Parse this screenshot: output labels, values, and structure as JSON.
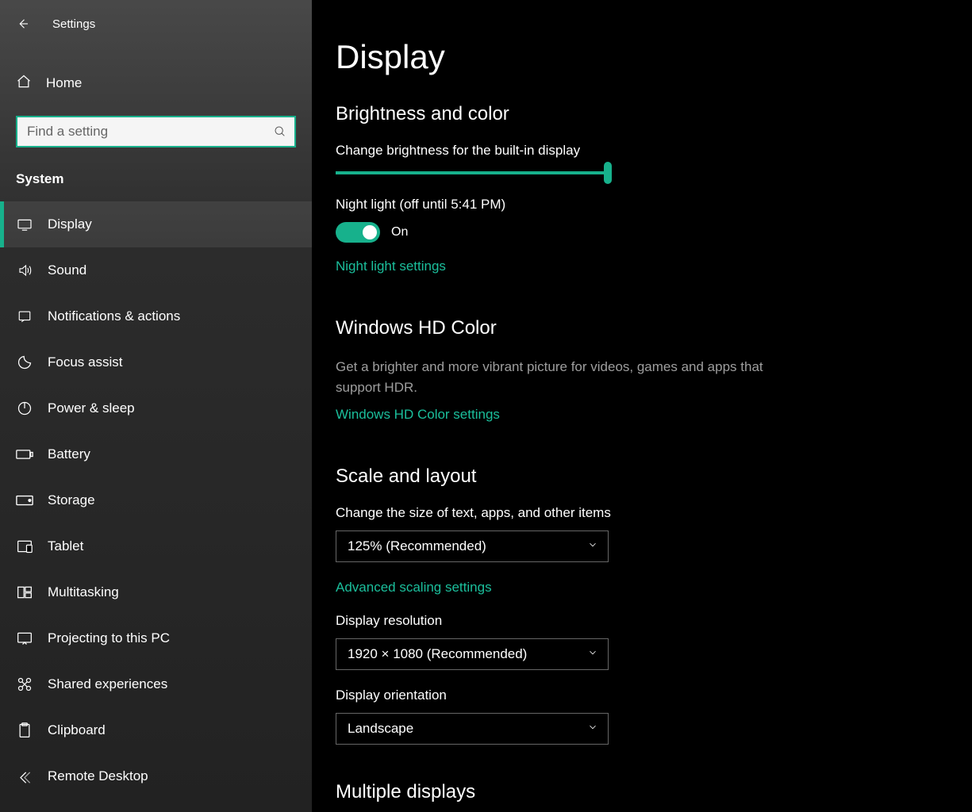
{
  "titlebar": {
    "title": "Settings"
  },
  "home": {
    "label": "Home"
  },
  "search": {
    "placeholder": "Find a setting"
  },
  "category": "System",
  "nav": {
    "items": [
      {
        "key": "display",
        "label": "Display",
        "active": true
      },
      {
        "key": "sound",
        "label": "Sound"
      },
      {
        "key": "notifications",
        "label": "Notifications & actions"
      },
      {
        "key": "focus",
        "label": "Focus assist"
      },
      {
        "key": "power",
        "label": "Power & sleep"
      },
      {
        "key": "battery",
        "label": "Battery"
      },
      {
        "key": "storage",
        "label": "Storage"
      },
      {
        "key": "tablet",
        "label": "Tablet"
      },
      {
        "key": "multitasking",
        "label": "Multitasking"
      },
      {
        "key": "projecting",
        "label": "Projecting to this PC"
      },
      {
        "key": "shared",
        "label": "Shared experiences"
      },
      {
        "key": "clipboard",
        "label": "Clipboard"
      },
      {
        "key": "remote",
        "label": "Remote Desktop"
      }
    ]
  },
  "page": {
    "title": "Display",
    "brightness": {
      "heading": "Brightness and color",
      "slider_label": "Change brightness for the built-in display",
      "night_light_label": "Night light (off until 5:41 PM)",
      "toggle_state": "On",
      "settings_link": "Night light settings"
    },
    "hdcolor": {
      "heading": "Windows HD Color",
      "desc": "Get a brighter and more vibrant picture for videos, games and apps that support HDR.",
      "link": "Windows HD Color settings"
    },
    "scale": {
      "heading": "Scale and layout",
      "size_label": "Change the size of text, apps, and other items",
      "size_value": "125% (Recommended)",
      "adv_link": "Advanced scaling settings",
      "res_label": "Display resolution",
      "res_value": "1920 × 1080 (Recommended)",
      "orient_label": "Display orientation",
      "orient_value": "Landscape"
    },
    "multiple": {
      "heading": "Multiple displays"
    }
  }
}
